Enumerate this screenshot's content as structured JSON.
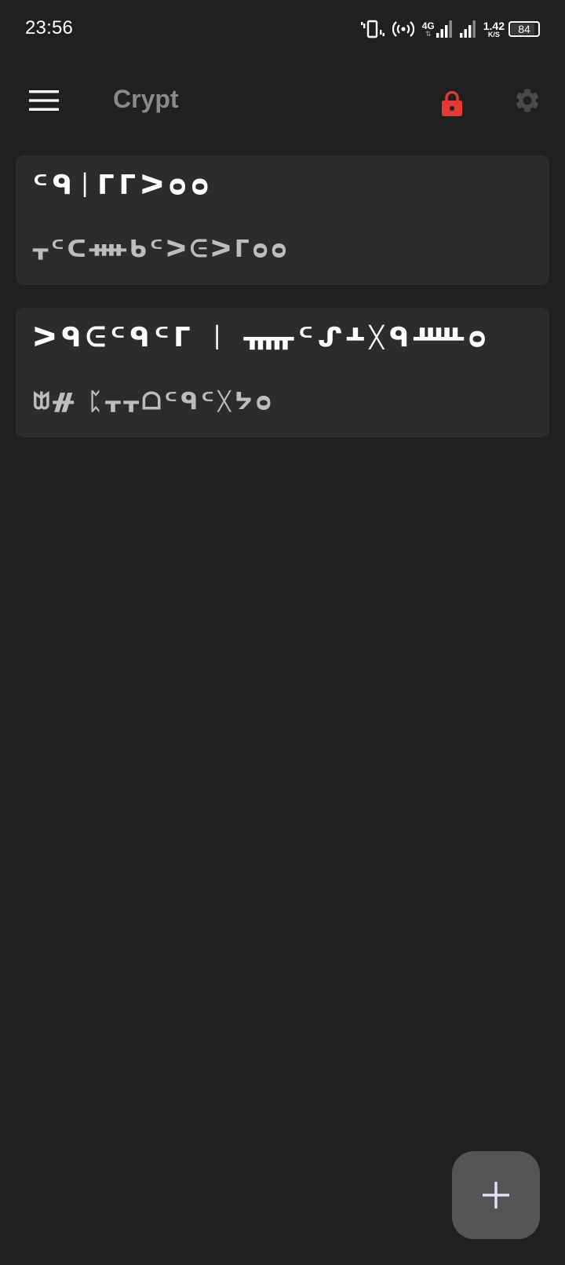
{
  "status_bar": {
    "time": "23:56",
    "network_type": "4G",
    "net_speed_value": "1.42",
    "net_speed_unit": "K/S",
    "battery_level": "84",
    "icons": [
      "vibrate-icon",
      "hotspot-icon",
      "signal-4g-icon",
      "signal-icon",
      "battery-icon"
    ]
  },
  "app_bar": {
    "title": "Crypt",
    "menu_icon": "hamburger-menu-icon",
    "lock_icon": "lock-icon",
    "settings_icon": "gear-icon",
    "lock_color": "#e53935",
    "title_color": "#8a8a8a"
  },
  "notes": [
    {
      "title": "ᒼᑫᛁᒥᒥᐳᴑᴑ",
      "preview": "ᚁᒼᑕᚓᑲᒼᐳᕮᐳᒥᴑᴑ"
    },
    {
      "title": "ᐳᑫᕮᒼᑫᒼᒥ ᛁ ᚅᒼᔑᚆᚷᑫᚊᴑ",
      "preview": "ᗻᚌ ᛈᚁᚁᗝᒼᑫᒼᚷᔭᴑ"
    }
  ],
  "fab": {
    "icon": "plus-icon",
    "label": "+"
  },
  "colors": {
    "background": "#202020",
    "card": "#2c2c2c",
    "fab": "#555555"
  }
}
